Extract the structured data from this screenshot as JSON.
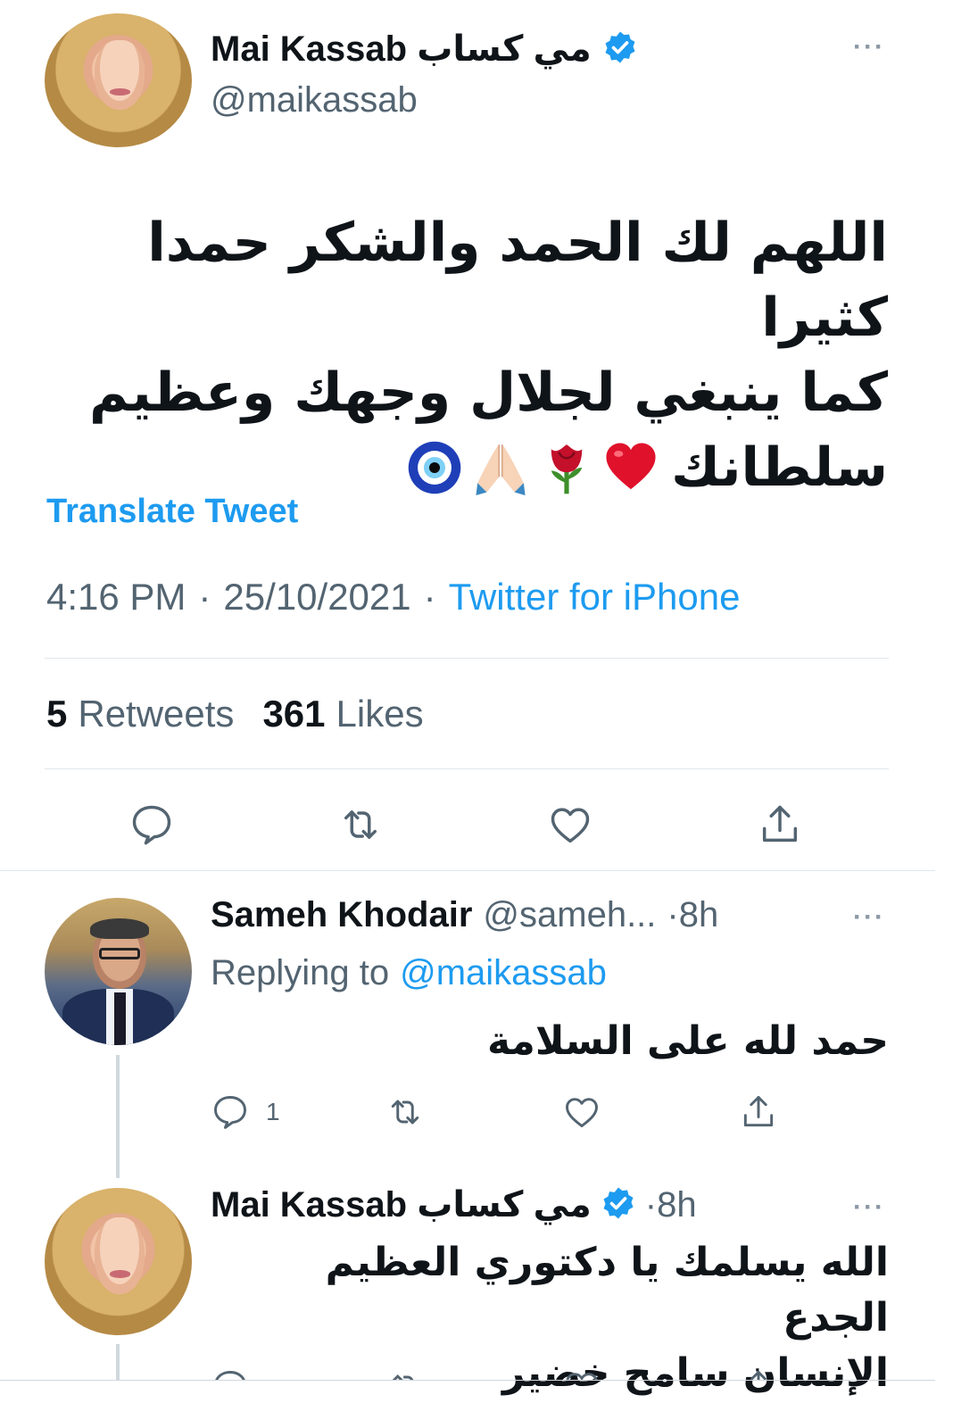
{
  "main_tweet": {
    "author_name": "Mai Kassab مي كساب",
    "handle": "@maikassab",
    "more_label": "···",
    "text_line1": "اللهم لك الحمد والشكر حمدا كثيرا",
    "text_line2": "كما ينبغي لجلال وجهك وعظيم",
    "text_line3": "سلطانك",
    "emojis": [
      "heart-emoji",
      "rose-emoji",
      "folded-hands-emoji",
      "nazar-amulet-emoji"
    ],
    "translate_label": "Translate Tweet",
    "time": "4:16 PM",
    "sep1": "·",
    "date": "25/10/2021",
    "sep2": "·",
    "source": "Twitter for iPhone",
    "retweets_count": "5",
    "retweets_label": "Retweets",
    "likes_count": "361",
    "likes_label": "Likes",
    "actions": [
      "reply-icon",
      "retweet-icon",
      "like-icon",
      "share-icon"
    ]
  },
  "reply1": {
    "author_name": "Sameh Khodair",
    "handle": "@sameh...",
    "time": "·8h",
    "more_label": "···",
    "replying_prefix": "Replying to",
    "replying_handle": "@maikassab",
    "text": "حمد لله على السلامة",
    "reply_count": "1"
  },
  "reply2": {
    "author_name": "Mai Kassab مي كساب",
    "time": "·8h",
    "more_label": "···",
    "text_line1": "الله يسلمك يا دكتوري العظيم الجدع",
    "text_line2": "الإنسان سامح خضير"
  },
  "colors": {
    "accent": "#1d9bf0",
    "secondary_text": "#536471",
    "divider": "#e1e6ea"
  }
}
